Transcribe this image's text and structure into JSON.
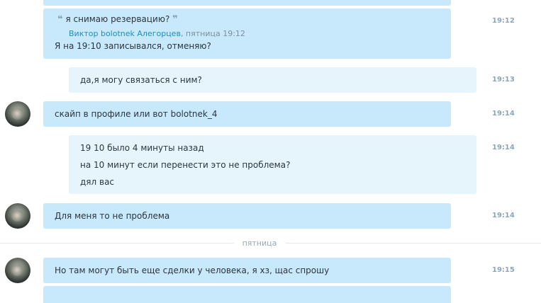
{
  "divider": {
    "label": "пятница"
  },
  "messages": [
    {
      "id": "m1",
      "quote": {
        "open": "❝",
        "text": "я снимаю резервацию?",
        "close": "❞",
        "author": "Виктор bolotnek Алегорцев",
        "meta": ", пятница 19:12"
      },
      "lines": [
        "Я на 19:10 записывался, отменяю?"
      ],
      "time": "19:12"
    },
    {
      "id": "m2",
      "lines": [
        "да,я могу связаться с ним?"
      ],
      "time": "19:13"
    },
    {
      "id": "m3",
      "lines": [
        "скайп в профиле или вот bolotnek_4"
      ],
      "time": "19:14"
    },
    {
      "id": "m4",
      "lines": [
        "19 10 было 4 минуты назад",
        "на 10 минут если перенести это не проблема?",
        "дял вас"
      ],
      "time": "19:14"
    },
    {
      "id": "m5",
      "lines": [
        "Для меня то не проблема"
      ],
      "time": "19:14"
    },
    {
      "id": "m6",
      "lines": [
        "Но там могут быть еще сделки у человека, я хз, щас спрошу"
      ],
      "time": "19:15"
    }
  ]
}
